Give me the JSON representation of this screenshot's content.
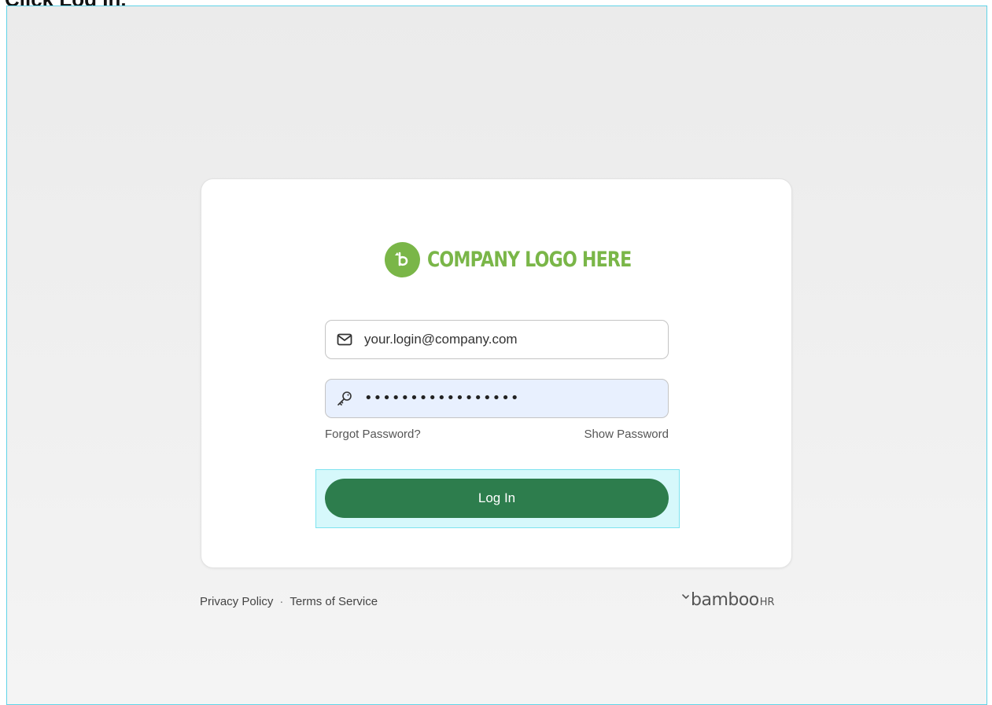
{
  "instruction": "Click Log In.",
  "logo": {
    "text": "COMPANY LOGO HERE",
    "mark": "b",
    "color": "#7ab648"
  },
  "login_form": {
    "email_value": "your.login@company.com",
    "password_mask": "•••••••••••••••••",
    "forgot_password": "Forgot Password?",
    "show_password": "Show Password",
    "login_button": "Log In",
    "button_color": "#2d7d4d"
  },
  "footer": {
    "privacy": "Privacy Policy",
    "separator": "·",
    "terms": "Terms of Service",
    "brand_main": "bamboo",
    "brand_suffix": "HR"
  },
  "icons": {
    "email": "envelope-icon",
    "password": "key-icon",
    "brand": "leaf-icon"
  }
}
